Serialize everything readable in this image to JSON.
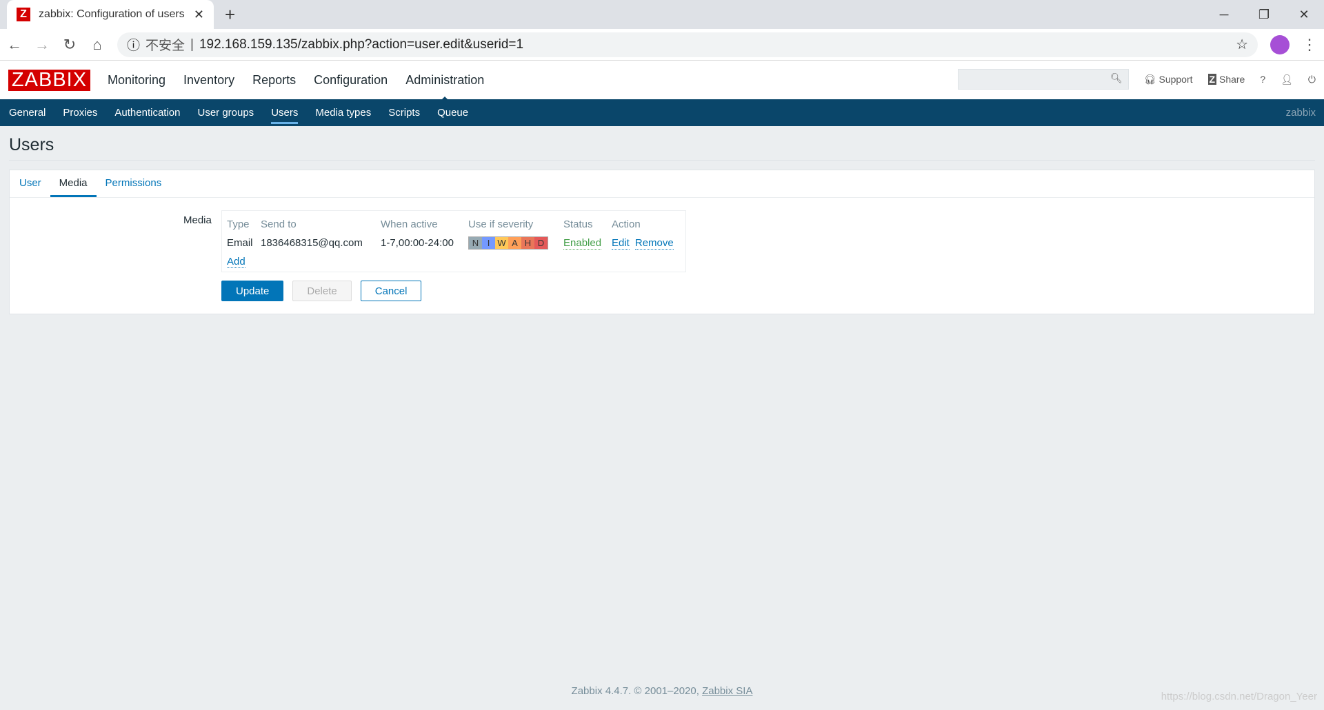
{
  "browser": {
    "tab_title": "zabbix: Configuration of users",
    "favicon": "Z",
    "insecure": "不安全",
    "url": "192.168.159.135/zabbix.php?action=user.edit&userid=1"
  },
  "header": {
    "logo": "ZABBIX",
    "nav": [
      "Monitoring",
      "Inventory",
      "Reports",
      "Configuration",
      "Administration"
    ],
    "selected": "Administration",
    "search_placeholder": "",
    "support": "Support",
    "share": "Share",
    "help": "?"
  },
  "subnav": {
    "items": [
      "General",
      "Proxies",
      "Authentication",
      "User groups",
      "Users",
      "Media types",
      "Scripts",
      "Queue"
    ],
    "selected": "Users",
    "server": "zabbix"
  },
  "page": {
    "title": "Users"
  },
  "form": {
    "tabs": [
      "User",
      "Media",
      "Permissions"
    ],
    "selected_tab": "Media",
    "media_label": "Media",
    "columns": [
      "Type",
      "Send to",
      "When active",
      "Use if severity",
      "Status",
      "Action"
    ],
    "rows": [
      {
        "type": "Email",
        "send_to": "1836468315@qq.com",
        "when_active": "1-7,00:00-24:00",
        "severity": [
          "N",
          "I",
          "W",
          "A",
          "H",
          "D"
        ],
        "status": "Enabled",
        "edit": "Edit",
        "remove": "Remove"
      }
    ],
    "add": "Add",
    "update": "Update",
    "delete": "Delete",
    "cancel": "Cancel"
  },
  "severity_colors": [
    "#97aab3",
    "#7499ff",
    "#ffc859",
    "#ffa059",
    "#e97659",
    "#e45959"
  ],
  "footer": {
    "text": "Zabbix 4.4.7. © 2001–2020, ",
    "link": "Zabbix SIA"
  },
  "watermark": "https://blog.csdn.net/Dragon_Yeer"
}
